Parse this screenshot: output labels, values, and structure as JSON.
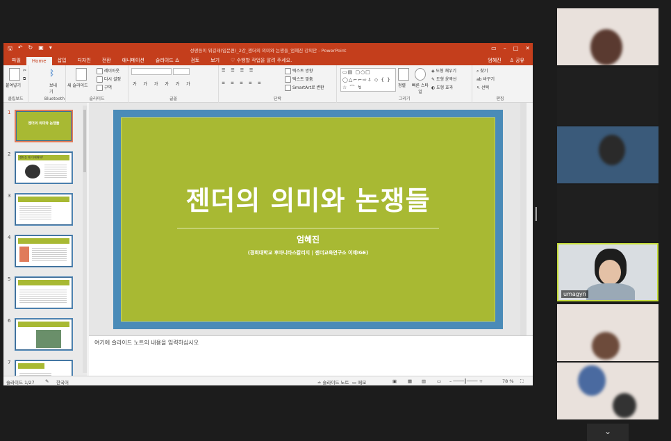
{
  "window": {
    "doc_title": "성평등이 뭐길래(입문편)_2강_젠더의 의미와 논쟁들_엄혜진 강의안 - PowerPoint",
    "user": "엄혜진",
    "share": "공유"
  },
  "tabs": [
    {
      "label": "파일"
    },
    {
      "label": "Home"
    },
    {
      "label": "삽입"
    },
    {
      "label": "디자인"
    },
    {
      "label": "전환"
    },
    {
      "label": "애니메이션"
    },
    {
      "label": "슬라이드 쇼"
    },
    {
      "label": "검토"
    },
    {
      "label": "보기"
    }
  ],
  "tell_me": "수행할 작업을 알려 주세요.",
  "ribbon": {
    "clipboard": {
      "paste": "붙여넣기",
      "label": "클립보드"
    },
    "bluetooth": {
      "send": "보내기",
      "label": "Bluetooth"
    },
    "slides": {
      "new_slide": "새 슬라이드",
      "layout": "레이아웃",
      "reset": "다시 설정",
      "section": "구역",
      "label": "슬라이드"
    },
    "font": {
      "label": "글꼴"
    },
    "paragraph": {
      "text_dir": "텍스트 방향",
      "align_text": "텍스트 맞춤",
      "smartart": "SmartArt로 변환",
      "label": "단락"
    },
    "drawing": {
      "arrange": "정렬",
      "quick_styles": "빠른 스타일",
      "fill": "도형 채우기",
      "outline": "도형 윤곽선",
      "effects": "도형 효과",
      "label": "그리기"
    },
    "editing": {
      "find": "찾기",
      "replace": "바꾸기",
      "select": "선택",
      "label": "편집"
    }
  },
  "thumbnails": [
    {
      "num": "1",
      "title": "젠더의 의미와 논쟁들"
    },
    {
      "num": "2",
      "title": "젠더는 왜 이해해야?"
    },
    {
      "num": "3",
      "title": ""
    },
    {
      "num": "4",
      "title": ""
    },
    {
      "num": "5",
      "title": ""
    },
    {
      "num": "6",
      "title": ""
    },
    {
      "num": "7",
      "title": ""
    }
  ],
  "slide": {
    "title": "젠더의 의미와 논쟁들",
    "author": "엄혜진",
    "affiliation": "(경희대학교 후마니타스칼리지 | 젠더교육연구소 이제IGE)"
  },
  "notes_placeholder": "여기에 슬라이드 노트의 내용을 입력하십시오",
  "status": {
    "slide_count": "슬라이드 1/27",
    "language": "한국어",
    "notes": "슬라이드 노트",
    "comments": "메모",
    "zoom": "78 %"
  },
  "participants": [
    {
      "name": "",
      "kind": "light"
    },
    {
      "name": "",
      "kind": "dark"
    },
    {
      "name": "",
      "kind": "blue"
    },
    {
      "name": "",
      "kind": "dark"
    },
    {
      "name": "umagyn",
      "kind": "active"
    },
    {
      "name": "",
      "kind": "light"
    },
    {
      "name": "",
      "kind": "light"
    }
  ],
  "colors": {
    "accent": "#c43e1c",
    "slide_green": "#a8b933",
    "slide_frame": "#4a8bb8",
    "active_speaker": "#c5dc3a"
  }
}
